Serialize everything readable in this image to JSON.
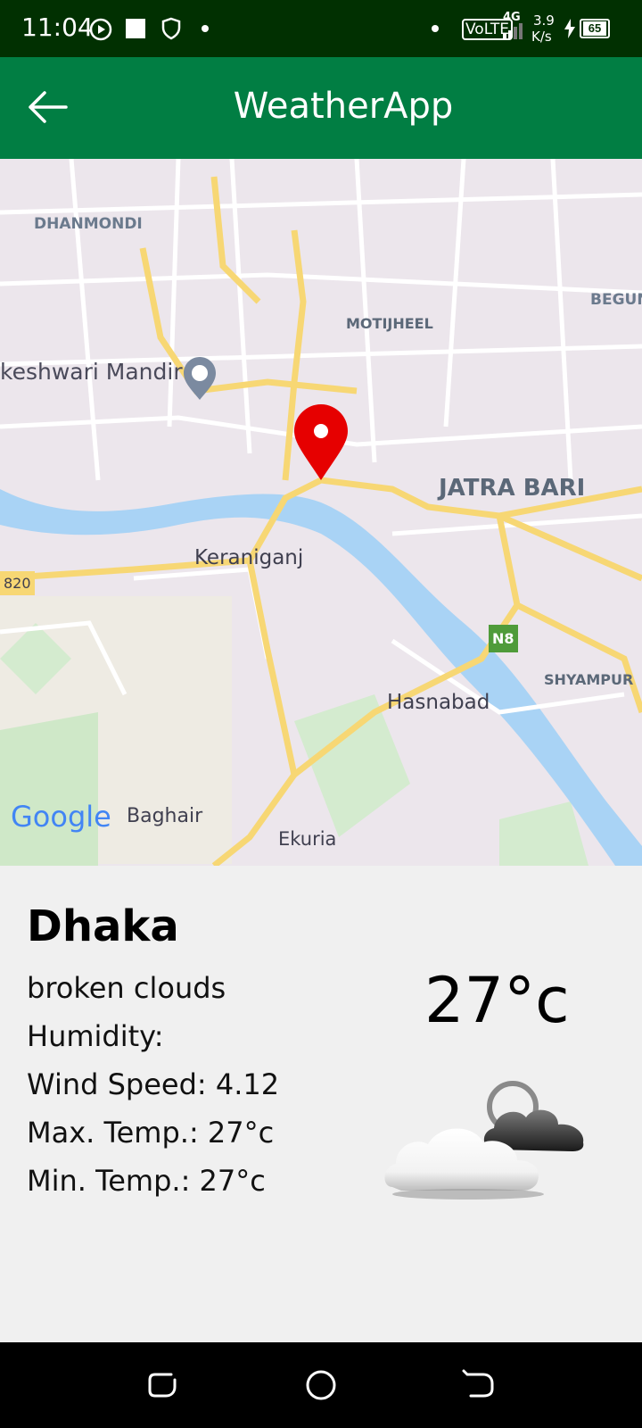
{
  "status_bar": {
    "time": "11:04",
    "network": "VoLTE",
    "signal_type": "4G",
    "speed_value": "3.9",
    "speed_unit": "K/s",
    "battery": "65"
  },
  "app_bar": {
    "title": "WeatherApp",
    "back_icon": "arrow-back-icon"
  },
  "map": {
    "labels": {
      "dhanmondi": "DHANMONDI",
      "motijheel": "MOTIJHEEL",
      "begun": "BEGUN",
      "mandir": "keshwari Mandir",
      "jatra_bari": "JATRA BARI",
      "keraniganj": "Keraniganj",
      "road_820": "820",
      "n8": "N8",
      "shyampur": "SHYAMPUR",
      "hasnabad": "Hasnabad",
      "baghair": "Baghair",
      "ekuria": "Ekuria"
    },
    "google_logo": "Google",
    "marker_color": "#e60000"
  },
  "weather": {
    "city": "Dhaka",
    "description": "broken clouds",
    "humidity": "Humidity:",
    "wind_speed": "Wind Speed: 4.12",
    "max_temp": "Max. Temp.: 27°c",
    "min_temp": "Min. Temp.: 27°c",
    "temperature": "27°c",
    "icon": "broken-clouds-icon"
  },
  "nav_bar": {
    "recents_icon": "recents-icon",
    "home_icon": "home-icon",
    "back_icon": "back-icon"
  },
  "colors": {
    "status_bar": "#013001",
    "app_bar": "#017e43",
    "panel_bg": "#f0f0f0"
  }
}
